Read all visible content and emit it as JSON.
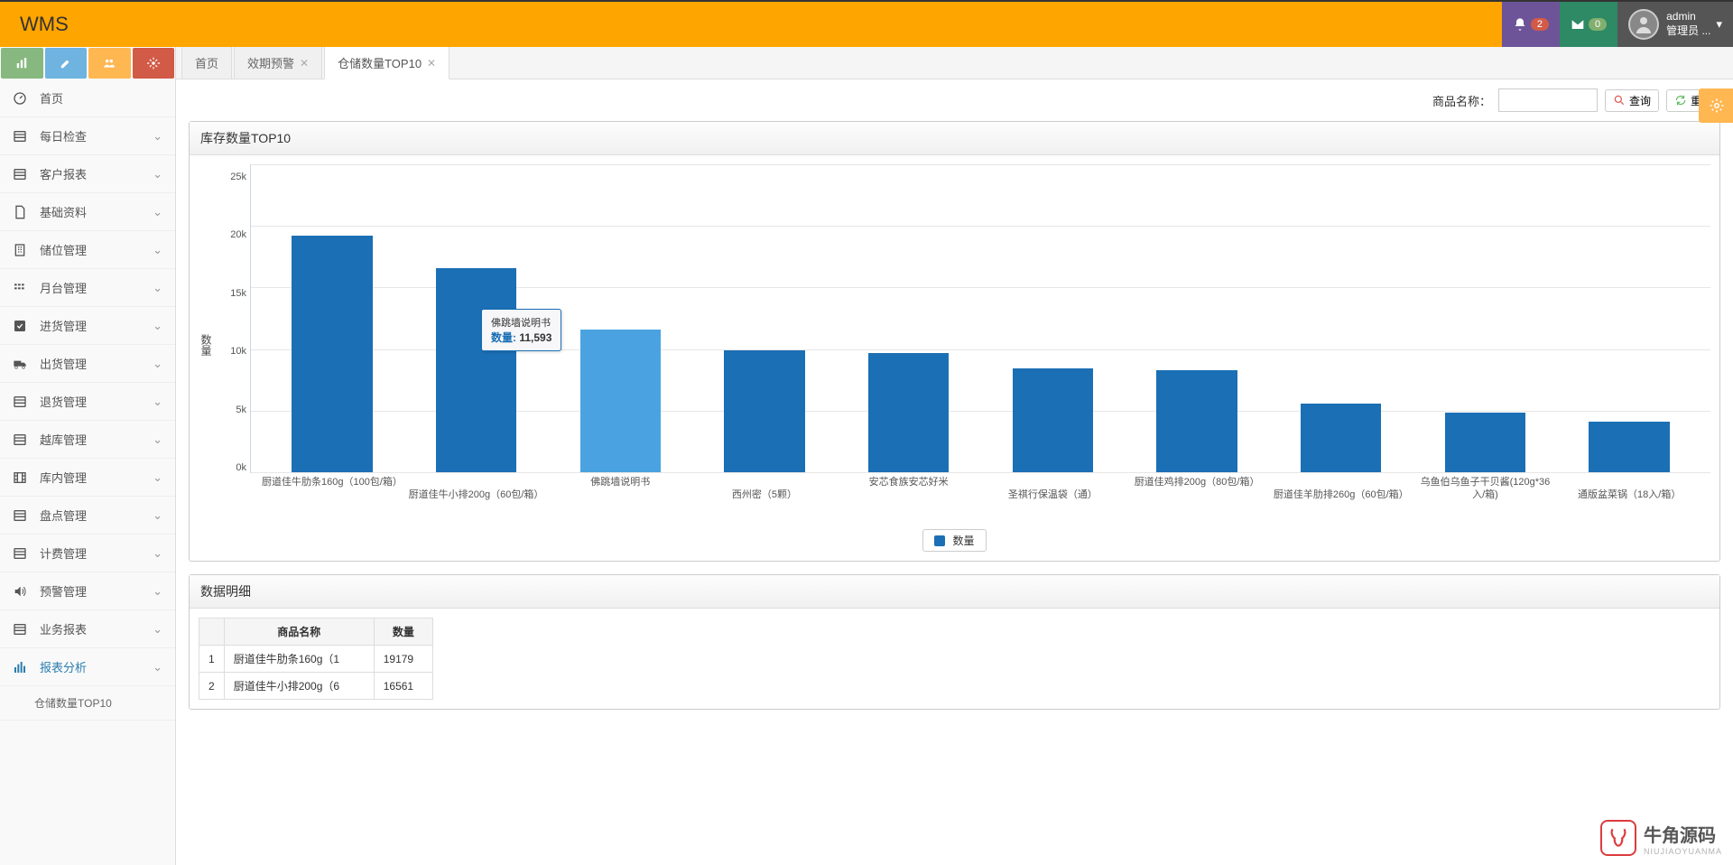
{
  "app": {
    "name": "WMS"
  },
  "header": {
    "notif_count": "2",
    "msg_count": "0",
    "user_name": "admin",
    "user_role": "管理员 ..."
  },
  "sidebar": {
    "items": [
      {
        "icon": "dashboard",
        "label": "首页",
        "expandable": false
      },
      {
        "icon": "list",
        "label": "每日检查",
        "expandable": true
      },
      {
        "icon": "list",
        "label": "客户报表",
        "expandable": true
      },
      {
        "icon": "file",
        "label": "基础资料",
        "expandable": true
      },
      {
        "icon": "building",
        "label": "储位管理",
        "expandable": true
      },
      {
        "icon": "grid",
        "label": "月台管理",
        "expandable": true
      },
      {
        "icon": "check",
        "label": "进货管理",
        "expandable": true
      },
      {
        "icon": "truck",
        "label": "出货管理",
        "expandable": true
      },
      {
        "icon": "list",
        "label": "退货管理",
        "expandable": true
      },
      {
        "icon": "list",
        "label": "越库管理",
        "expandable": true
      },
      {
        "icon": "film",
        "label": "库内管理",
        "expandable": true
      },
      {
        "icon": "list",
        "label": "盘点管理",
        "expandable": true
      },
      {
        "icon": "list",
        "label": "计费管理",
        "expandable": true
      },
      {
        "icon": "volume",
        "label": "预警管理",
        "expandable": true
      },
      {
        "icon": "list",
        "label": "业务报表",
        "expandable": true
      },
      {
        "icon": "bars",
        "label": "报表分析",
        "expandable": true,
        "active": true
      }
    ],
    "submenu_active": "仓储数量TOP10"
  },
  "tabs": [
    {
      "label": "首页",
      "closable": false,
      "active": false
    },
    {
      "label": "效期预警",
      "closable": true,
      "active": false
    },
    {
      "label": "仓储数量TOP10",
      "closable": true,
      "active": true
    }
  ],
  "filter": {
    "label": "商品名称：",
    "search_btn": "查询",
    "reset_btn": "重置"
  },
  "panel_chart_title": "库存数量TOP10",
  "panel_table_title": "数据明细",
  "chart_data": {
    "type": "bar",
    "ylabel": "数量",
    "ylim": [
      0,
      25000
    ],
    "yticks": [
      "25k",
      "20k",
      "15k",
      "10k",
      "5k",
      "0k"
    ],
    "legend": "数量",
    "tooltip": {
      "name": "佛跳墙说明书",
      "label": "数量:",
      "value": "11,593",
      "hover_index": 2
    },
    "categories_row1": [
      "厨道佳牛肋条160g（100包/箱）",
      "",
      "佛跳墙说明书",
      "",
      "安芯食族安芯好米",
      "",
      "厨道佳鸡排200g（80包/箱）",
      "",
      "乌鱼伯乌鱼子干贝酱(120g*36入/箱)",
      ""
    ],
    "categories_row2": [
      "",
      "厨道佳牛小排200g（60包/箱）",
      "",
      "西州密（5颗）",
      "",
      "圣祺行保温袋（通）",
      "",
      "厨道佳羊肋排260g（60包/箱）",
      "",
      "通版盆菜锅（18入/箱）"
    ],
    "values": [
      19179,
      16561,
      11593,
      9900,
      9700,
      8400,
      8300,
      5600,
      4850,
      4100
    ]
  },
  "table": {
    "headers": [
      "",
      "商品名称",
      "数量"
    ],
    "rows": [
      {
        "idx": "1",
        "name": "厨道佳牛肋条160g（1",
        "qty": "19179"
      },
      {
        "idx": "2",
        "name": "厨道佳牛小排200g（6",
        "qty": "16561"
      }
    ]
  },
  "watermark": {
    "text": "牛角源码",
    "sub": "NIUJIAOYUANMA"
  }
}
